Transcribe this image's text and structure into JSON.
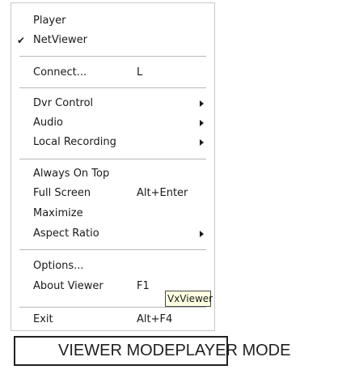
{
  "menu": {
    "items": [
      {
        "label": "Player",
        "shortcut": "",
        "checked": false,
        "submenu": false
      },
      {
        "label": "NetViewer",
        "shortcut": "",
        "checked": true,
        "submenu": false
      },
      {
        "label": "Connect...",
        "shortcut": "L",
        "checked": false,
        "submenu": false
      },
      {
        "label": "Dvr Control",
        "shortcut": "",
        "checked": false,
        "submenu": true
      },
      {
        "label": "Audio",
        "shortcut": "",
        "checked": false,
        "submenu": true
      },
      {
        "label": "Local Recording",
        "shortcut": "",
        "checked": false,
        "submenu": true
      },
      {
        "label": "Always On Top",
        "shortcut": "",
        "checked": false,
        "submenu": false
      },
      {
        "label": "Full Screen",
        "shortcut": "Alt+Enter",
        "checked": false,
        "submenu": false
      },
      {
        "label": "Maximize",
        "shortcut": "",
        "checked": false,
        "submenu": false
      },
      {
        "label": "Aspect Ratio",
        "shortcut": "",
        "checked": false,
        "submenu": true
      },
      {
        "label": "Options...",
        "shortcut": "",
        "checked": false,
        "submenu": false
      },
      {
        "label": "About Viewer",
        "shortcut": "F1",
        "checked": false,
        "submenu": false
      },
      {
        "label": "Exit",
        "shortcut": "Alt+F4",
        "checked": false,
        "submenu": false
      }
    ],
    "check_glyph": "✔"
  },
  "tooltip": {
    "text": "VxViewer"
  },
  "mode_bar": {
    "text": "VIEWER MODEPLAYER MODE"
  }
}
